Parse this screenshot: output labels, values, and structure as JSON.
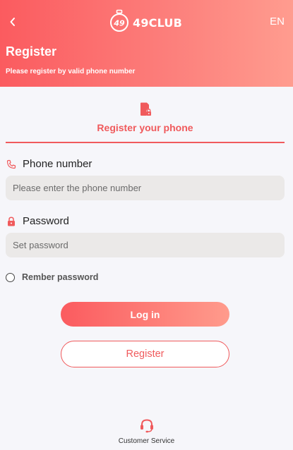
{
  "header": {
    "logo_text": "49CLUB",
    "lang": "EN",
    "title": "Register",
    "subtitle": "Please register by valid phone number"
  },
  "tab": {
    "label": "Register your phone",
    "icon": "phone-lock-icon"
  },
  "phone": {
    "label": "Phone number",
    "placeholder": "Please enter the phone number",
    "icon": "phone-icon"
  },
  "password": {
    "label": "Password",
    "placeholder": "Set password",
    "icon": "lock-icon"
  },
  "remember": {
    "label": "Rember password"
  },
  "buttons": {
    "login": "Log in",
    "register": "Register"
  },
  "footer": {
    "customer_service": "Customer Service",
    "icon": "headset-icon"
  },
  "colors": {
    "accent": "#f05a5c",
    "header_start": "#fb5b5f",
    "header_end": "#ff9c8f",
    "input_bg": "#ebe9e8",
    "page_bg": "#f6f6fa"
  }
}
